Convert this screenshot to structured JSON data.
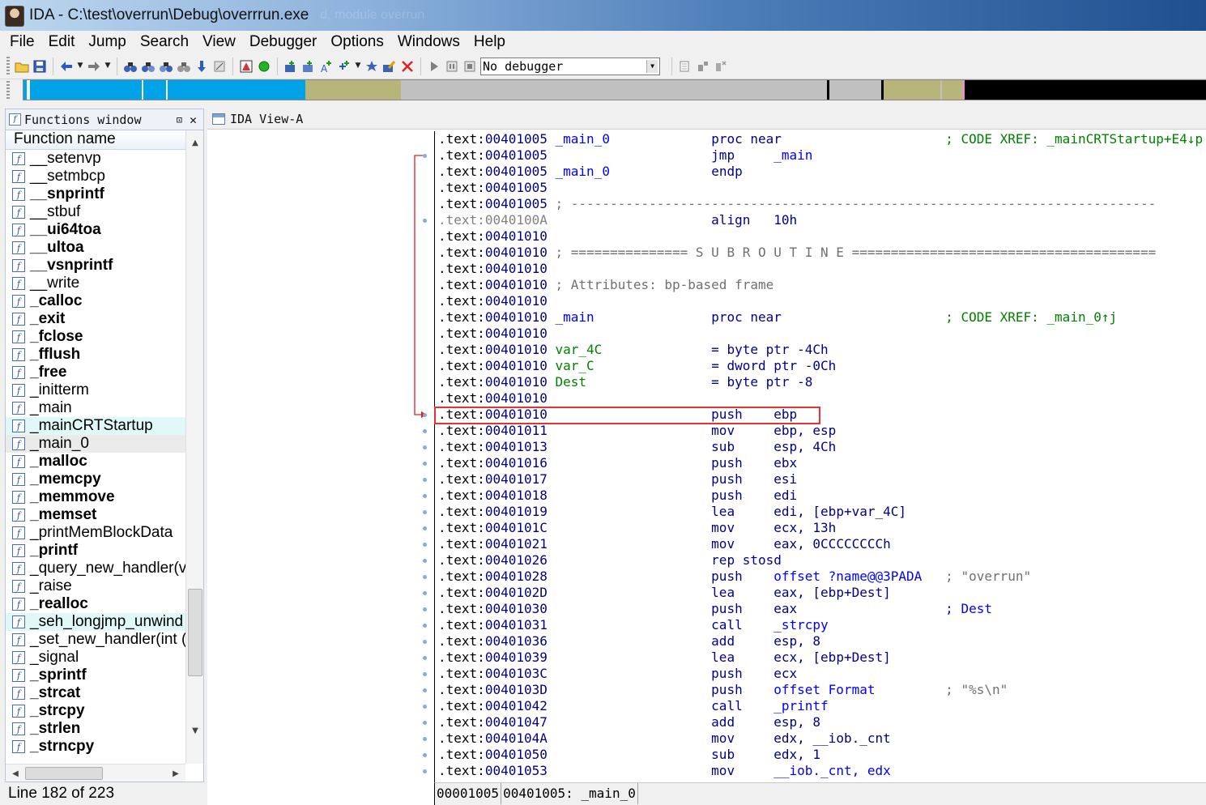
{
  "window": {
    "title": "IDA - C:\\test\\overrun\\Debug\\overrrun.exe",
    "ghost_text": "d, module overrun"
  },
  "menu": [
    "File",
    "Edit",
    "Jump",
    "Search",
    "View",
    "Debugger",
    "Options",
    "Windows",
    "Help"
  ],
  "toolbar": {
    "debugger_select": "No debugger"
  },
  "colors": {
    "nav_library": "#00a3e8",
    "nav_data": "#b7b57a",
    "nav_unexplored": "#c0c0c0",
    "nav_external": "#000000",
    "highlight_box": "#e53333"
  },
  "functions_window": {
    "tab_label": "Functions window",
    "column_header": "Function name",
    "status": "Line 182 of 223",
    "items": [
      {
        "name": "__setenvp",
        "bold": false
      },
      {
        "name": "__setmbcp",
        "bold": false
      },
      {
        "name": "__snprintf",
        "bold": true
      },
      {
        "name": "__stbuf",
        "bold": false
      },
      {
        "name": "__ui64toa",
        "bold": true
      },
      {
        "name": "__ultoa",
        "bold": true
      },
      {
        "name": "__vsnprintf",
        "bold": true
      },
      {
        "name": "__write",
        "bold": false
      },
      {
        "name": "_calloc",
        "bold": true
      },
      {
        "name": "_exit",
        "bold": true
      },
      {
        "name": "_fclose",
        "bold": true
      },
      {
        "name": "_fflush",
        "bold": true
      },
      {
        "name": "_free",
        "bold": true
      },
      {
        "name": "_initterm",
        "bold": false
      },
      {
        "name": "_main",
        "bold": false
      },
      {
        "name": "_mainCRTStartup",
        "bold": false,
        "highlight": true
      },
      {
        "name": "_main_0",
        "bold": false,
        "selected": true
      },
      {
        "name": "_malloc",
        "bold": true
      },
      {
        "name": "_memcpy",
        "bold": true
      },
      {
        "name": "_memmove",
        "bold": true
      },
      {
        "name": "_memset",
        "bold": true
      },
      {
        "name": "_printMemBlockData",
        "bold": false
      },
      {
        "name": "_printf",
        "bold": true
      },
      {
        "name": "_query_new_handler(v",
        "bold": false
      },
      {
        "name": "_raise",
        "bold": false
      },
      {
        "name": "_realloc",
        "bold": true
      },
      {
        "name": "_seh_longjmp_unwind",
        "bold": false,
        "highlight": true
      },
      {
        "name": "_set_new_handler(int (",
        "bold": false
      },
      {
        "name": "_signal",
        "bold": false
      },
      {
        "name": "_sprintf",
        "bold": true
      },
      {
        "name": "_strcat",
        "bold": true
      },
      {
        "name": "_strcpy",
        "bold": true
      },
      {
        "name": "_strlen",
        "bold": true
      },
      {
        "name": "_strncpy",
        "bold": true
      }
    ]
  },
  "ida_view": {
    "tab_label": "IDA View-A",
    "status": {
      "offset": "00001005",
      "address": "00401005:",
      "func": "_main_0"
    },
    "lines": [
      {
        "seg": ".text",
        "addr": "00401005",
        "label": "_main_0",
        "mnem": "proc near",
        "ops": "",
        "comment": "; CODE XREF: _mainCRTStartup+E4↓p"
      },
      {
        "seg": ".text",
        "addr": "00401005",
        "label": "",
        "mnem": "jmp",
        "ops": "_main",
        "comment": ""
      },
      {
        "seg": ".text",
        "addr": "00401005",
        "label": "_main_0",
        "mnem": "endp",
        "ops": "",
        "comment": ""
      },
      {
        "seg": ".text",
        "addr": "00401005",
        "label": "",
        "mnem": "",
        "ops": "",
        "comment": ""
      },
      {
        "seg": ".text",
        "addr": "00401005",
        "label": "",
        "mnem": "",
        "ops": "",
        "comment": "; ---------------------------------------------------------------------------",
        "full": true
      },
      {
        "seg": ".text",
        "addr": "0040100A",
        "label": "",
        "mnem": "align",
        "ops": "10h",
        "comment": "",
        "gray": true
      },
      {
        "seg": ".text",
        "addr": "00401010",
        "label": "",
        "mnem": "",
        "ops": "",
        "comment": ""
      },
      {
        "seg": ".text",
        "addr": "00401010",
        "label": "",
        "mnem": "",
        "ops": "",
        "comment": "; =============== S U B R O U T I N E =======================================",
        "full": true
      },
      {
        "seg": ".text",
        "addr": "00401010",
        "label": "",
        "mnem": "",
        "ops": "",
        "comment": ""
      },
      {
        "seg": ".text",
        "addr": "00401010",
        "label": "",
        "mnem": "",
        "ops": "",
        "comment": "; Attributes: bp-based frame",
        "full": true
      },
      {
        "seg": ".text",
        "addr": "00401010",
        "label": "",
        "mnem": "",
        "ops": "",
        "comment": ""
      },
      {
        "seg": ".text",
        "addr": "00401010",
        "label": "_main",
        "mnem": "proc near",
        "ops": "",
        "comment": "; CODE XREF: _main_0↑j"
      },
      {
        "seg": ".text",
        "addr": "00401010",
        "label": "",
        "mnem": "",
        "ops": "",
        "comment": ""
      },
      {
        "seg": ".text",
        "addr": "00401010",
        "label": "var_4C",
        "mnem": "= byte ptr -4Ch",
        "ops": "",
        "comment": "",
        "var": true
      },
      {
        "seg": ".text",
        "addr": "00401010",
        "label": "var_C",
        "mnem": "= dword ptr -0Ch",
        "ops": "",
        "comment": "",
        "var": true
      },
      {
        "seg": ".text",
        "addr": "00401010",
        "label": "Dest",
        "mnem": "= byte ptr -8",
        "ops": "",
        "comment": "",
        "var": true
      },
      {
        "seg": ".text",
        "addr": "00401010",
        "label": "",
        "mnem": "",
        "ops": "",
        "comment": ""
      },
      {
        "seg": ".text",
        "addr": "00401010",
        "label": "",
        "mnem": "push",
        "ops": "ebp",
        "comment": ""
      },
      {
        "seg": ".text",
        "addr": "00401011",
        "label": "",
        "mnem": "mov",
        "ops": "ebp, esp",
        "comment": ""
      },
      {
        "seg": ".text",
        "addr": "00401013",
        "label": "",
        "mnem": "sub",
        "ops": "esp, 4Ch",
        "comment": ""
      },
      {
        "seg": ".text",
        "addr": "00401016",
        "label": "",
        "mnem": "push",
        "ops": "ebx",
        "comment": ""
      },
      {
        "seg": ".text",
        "addr": "00401017",
        "label": "",
        "mnem": "push",
        "ops": "esi",
        "comment": ""
      },
      {
        "seg": ".text",
        "addr": "00401018",
        "label": "",
        "mnem": "push",
        "ops": "edi",
        "comment": ""
      },
      {
        "seg": ".text",
        "addr": "00401019",
        "label": "",
        "mnem": "lea",
        "ops": "edi, [ebp+var_4C]",
        "comment": ""
      },
      {
        "seg": ".text",
        "addr": "0040101C",
        "label": "",
        "mnem": "mov",
        "ops": "ecx, 13h",
        "comment": ""
      },
      {
        "seg": ".text",
        "addr": "00401021",
        "label": "",
        "mnem": "mov",
        "ops": "eax, 0CCCCCCCCh",
        "comment": ""
      },
      {
        "seg": ".text",
        "addr": "00401026",
        "label": "",
        "mnem": "rep stosd",
        "ops": "",
        "comment": ""
      },
      {
        "seg": ".text",
        "addr": "00401028",
        "label": "",
        "mnem": "push",
        "ops": "offset ?name@@3PADA",
        "comment": "; \"overrun\""
      },
      {
        "seg": ".text",
        "addr": "0040102D",
        "label": "",
        "mnem": "lea",
        "ops": "eax, [ebp+Dest]",
        "comment": ""
      },
      {
        "seg": ".text",
        "addr": "00401030",
        "label": "",
        "mnem": "push",
        "ops": "eax",
        "comment": "; Dest"
      },
      {
        "seg": ".text",
        "addr": "00401031",
        "label": "",
        "mnem": "call",
        "ops": "_strcpy",
        "comment": ""
      },
      {
        "seg": ".text",
        "addr": "00401036",
        "label": "",
        "mnem": "add",
        "ops": "esp, 8",
        "comment": ""
      },
      {
        "seg": ".text",
        "addr": "00401039",
        "label": "",
        "mnem": "lea",
        "ops": "ecx, [ebp+Dest]",
        "comment": ""
      },
      {
        "seg": ".text",
        "addr": "0040103C",
        "label": "",
        "mnem": "push",
        "ops": "ecx",
        "comment": ""
      },
      {
        "seg": ".text",
        "addr": "0040103D",
        "label": "",
        "mnem": "push",
        "ops": "offset Format",
        "comment": "; \"%s\\n\""
      },
      {
        "seg": ".text",
        "addr": "00401042",
        "label": "",
        "mnem": "call",
        "ops": "_printf",
        "comment": ""
      },
      {
        "seg": ".text",
        "addr": "00401047",
        "label": "",
        "mnem": "add",
        "ops": "esp, 8",
        "comment": ""
      },
      {
        "seg": ".text",
        "addr": "0040104A",
        "label": "",
        "mnem": "mov",
        "ops": "edx, __iob._cnt",
        "comment": ""
      },
      {
        "seg": ".text",
        "addr": "00401050",
        "label": "",
        "mnem": "sub",
        "ops": "edx, 1",
        "comment": ""
      },
      {
        "seg": ".text",
        "addr": "00401053",
        "label": "",
        "mnem": "mov",
        "ops": "__iob._cnt, edx",
        "comment": ""
      }
    ]
  }
}
